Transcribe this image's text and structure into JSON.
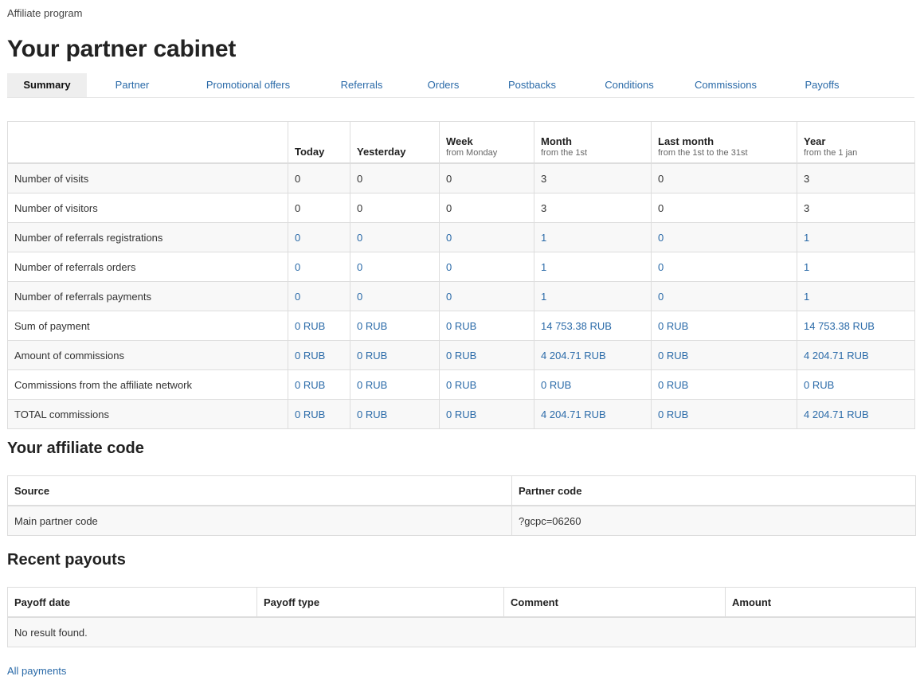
{
  "breadcrumb": "Affiliate program",
  "title": "Your partner cabinet",
  "tabs": [
    "Summary",
    "Partner",
    "Promotional offers",
    "Referrals",
    "Orders",
    "Postbacks",
    "Conditions",
    "Commissions",
    "Payoffs"
  ],
  "stats": {
    "headers": [
      {
        "label": "Today",
        "sub": ""
      },
      {
        "label": "Yesterday",
        "sub": ""
      },
      {
        "label": "Week",
        "sub": "from Monday"
      },
      {
        "label": "Month",
        "sub": "from the 1st"
      },
      {
        "label": "Last month",
        "sub": "from the 1st to the 31st"
      },
      {
        "label": "Year",
        "sub": "from the 1 jan"
      }
    ],
    "rows": [
      {
        "label": "Number of visits",
        "values": [
          "0",
          "0",
          "0",
          "3",
          "0",
          "3"
        ],
        "link": false
      },
      {
        "label": "Number of visitors",
        "values": [
          "0",
          "0",
          "0",
          "3",
          "0",
          "3"
        ],
        "link": false
      },
      {
        "label": "Number of referrals registrations",
        "values": [
          "0",
          "0",
          "0",
          "1",
          "0",
          "1"
        ],
        "link": true
      },
      {
        "label": "Number of referrals orders",
        "values": [
          "0",
          "0",
          "0",
          "1",
          "0",
          "1"
        ],
        "link": true
      },
      {
        "label": "Number of referrals payments",
        "values": [
          "0",
          "0",
          "0",
          "1",
          "0",
          "1"
        ],
        "link": true
      },
      {
        "label": "Sum of payment",
        "values": [
          "0 RUB",
          "0 RUB",
          "0 RUB",
          "14 753.38 RUB",
          "0 RUB",
          "14 753.38 RUB"
        ],
        "link": true
      },
      {
        "label": "Amount of commissions",
        "values": [
          "0 RUB",
          "0 RUB",
          "0 RUB",
          "4 204.71 RUB",
          "0 RUB",
          "4 204.71 RUB"
        ],
        "link": true
      },
      {
        "label": "Commissions from the affiliate network",
        "values": [
          "0 RUB",
          "0 RUB",
          "0 RUB",
          "0 RUB",
          "0 RUB",
          "0 RUB"
        ],
        "link": true
      },
      {
        "label": "TOTAL commissions",
        "values": [
          "0 RUB",
          "0 RUB",
          "0 RUB",
          "4 204.71 RUB",
          "0 RUB",
          "4 204.71 RUB"
        ],
        "link": true
      }
    ]
  },
  "affiliate_code": {
    "heading": "Your affiliate code",
    "headers": [
      "Source",
      "Partner code"
    ],
    "row": {
      "source": "Main partner code",
      "code": "?gcpc=06260"
    }
  },
  "payouts": {
    "heading": "Recent payouts",
    "headers": [
      "Payoff date",
      "Payoff type",
      "Comment",
      "Amount"
    ],
    "empty": "No result found.",
    "all_link": "All payments"
  }
}
